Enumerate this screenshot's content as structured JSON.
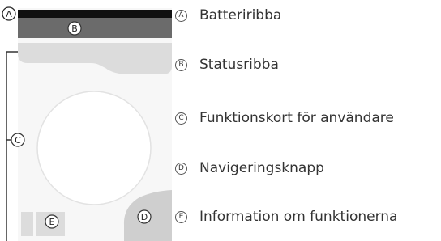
{
  "markers": {
    "A": "A",
    "B": "B",
    "C": "C",
    "D": "D",
    "E": "E"
  },
  "legend": [
    {
      "marker": "A",
      "label": "Batteriribba"
    },
    {
      "marker": "B",
      "label": "Statusribba"
    },
    {
      "marker": "C",
      "label": "Funktionskort för användare"
    },
    {
      "marker": "D",
      "label": "Navigeringsknapp"
    },
    {
      "marker": "E",
      "label": "Information om funktionerna"
    }
  ],
  "colors": {
    "battery_bar": "#111111",
    "status_bar": "#6b6b6b",
    "panel": "#dcdcdc",
    "nav_button": "#cfcfcf",
    "outline": "#555555"
  }
}
